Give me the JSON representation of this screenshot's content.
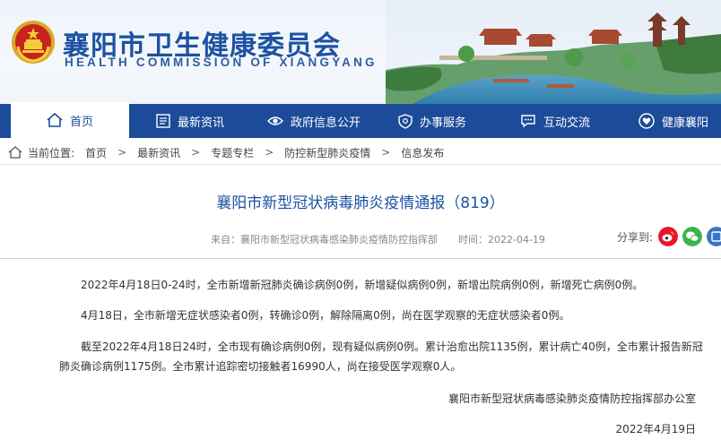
{
  "site": {
    "name_cn": "襄阳市卫生健康委员会",
    "name_en": "HEALTH COMMISSION OF XIANGYANG"
  },
  "nav": [
    {
      "label": "首页",
      "icon": "home-icon"
    },
    {
      "label": "最新资讯",
      "icon": "news-icon"
    },
    {
      "label": "政府信息公开",
      "icon": "eye-icon"
    },
    {
      "label": "办事服务",
      "icon": "shield-icon"
    },
    {
      "label": "互动交流",
      "icon": "chat-icon"
    },
    {
      "label": "健康襄阳",
      "icon": "heart-icon"
    }
  ],
  "breadcrumb": {
    "prefix": "当前位置:",
    "items": [
      "首页",
      "最新资讯",
      "专题专栏",
      "防控新型肺炎疫情",
      "信息发布"
    ]
  },
  "article": {
    "title": "襄阳市新型冠状病毒肺炎疫情通报（819）",
    "source": "来自：襄阳市新型冠状病毒感染肺炎疫情防控指挥部",
    "date": "时间：2022-04-19",
    "share_label": "分享到:",
    "paragraphs": [
      "2022年4月18日0-24时，全市新增新冠肺炎确诊病例0例，新增疑似病例0例，新增出院病例0例，新增死亡病例0例。",
      "4月18日，全市新增无症状感染者0例，转确诊0例，解除隔离0例，尚在医学观察的无症状感染者0例。",
      "截至2022年4月18日24时，全市现有确诊病例0例，现有疑似病例0例。累计治愈出院1135例，累计病亡40例，全市累计报告新冠",
      "肺炎确诊病例1175例。全市累计追踪密切接触者16990人，尚在接受医学观察0人。"
    ],
    "signature": "襄阳市新型冠状病毒感染肺炎疫情防控指挥部办公室",
    "sign_date": "2022年4月19日"
  },
  "colors": {
    "nav_bg": "#1c4b99",
    "title": "#1d52a3",
    "weibo": "#e6162d",
    "wechat": "#3bb54a",
    "other": "#3a73c9"
  }
}
